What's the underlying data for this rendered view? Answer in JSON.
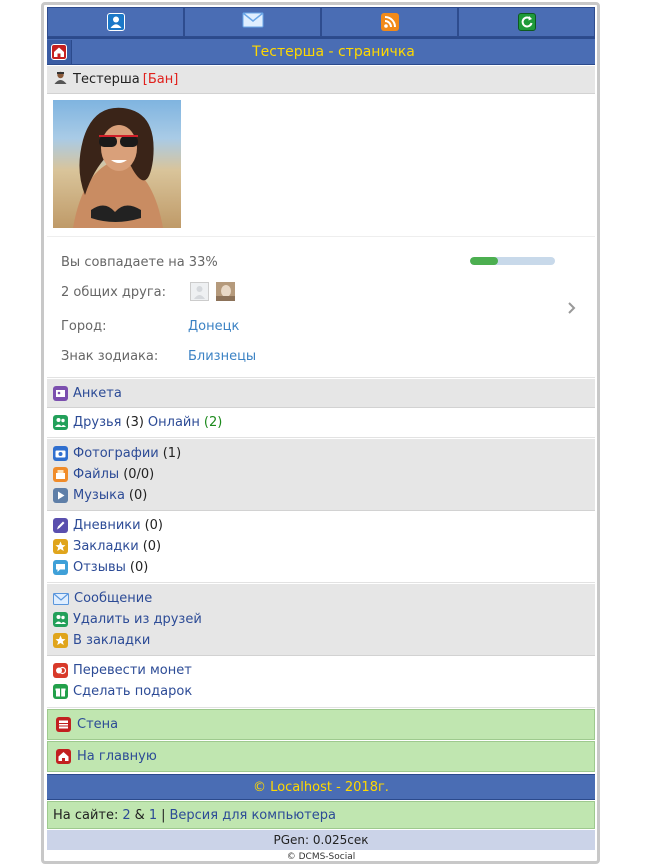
{
  "nav": {
    "icons": [
      "user-icon",
      "mail-icon",
      "rss-icon",
      "refresh-icon"
    ]
  },
  "title": "Тестерша - страничка",
  "user": {
    "name": "Тестерша",
    "ban": "[Бан]"
  },
  "info": {
    "match_label": "Вы совпадаете на 33%",
    "match_percent": 33,
    "friends_label": "2 общих друга:",
    "city_label": "Город:",
    "city_value": "Донецк",
    "zodiac_label": "Знак зодиака:",
    "zodiac_value": "Близнецы"
  },
  "menu": {
    "anketa": "Анкета",
    "friends": "Друзья",
    "friends_count": "(3)",
    "online": "Онлайн",
    "online_count": "(2)",
    "photos": "Фотографии",
    "photos_count": "(1)",
    "files": "Файлы",
    "files_count": "(0/0)",
    "music": "Музыка",
    "music_count": "(0)",
    "diaries": "Дневники",
    "diaries_count": "(0)",
    "bookmarks": "Закладки",
    "bookmarks_count": "(0)",
    "reviews": "Отзывы",
    "reviews_count": "(0)",
    "message": "Сообщение",
    "remove_friend": "Удалить из друзей",
    "to_bookmarks": "В закладки",
    "transfer": "Перевести монет",
    "gift": "Сделать подарок",
    "wall": "Стена",
    "home": "На главную"
  },
  "footer": {
    "copyright": "© Localhost - 2018г.",
    "online_prefix": "На сайте:",
    "online_a": "2",
    "amp": "&",
    "online_b": "1",
    "sep": "|",
    "desktop": "Версия для компьютера",
    "pgen": "PGen: 0.025сек",
    "engine": "© DCMS-Social"
  },
  "colors": {
    "nav_bg": "#4a6db4",
    "title_text": "#ffd800",
    "green_row": "#c0e6b0",
    "link": "#2c4b96"
  }
}
